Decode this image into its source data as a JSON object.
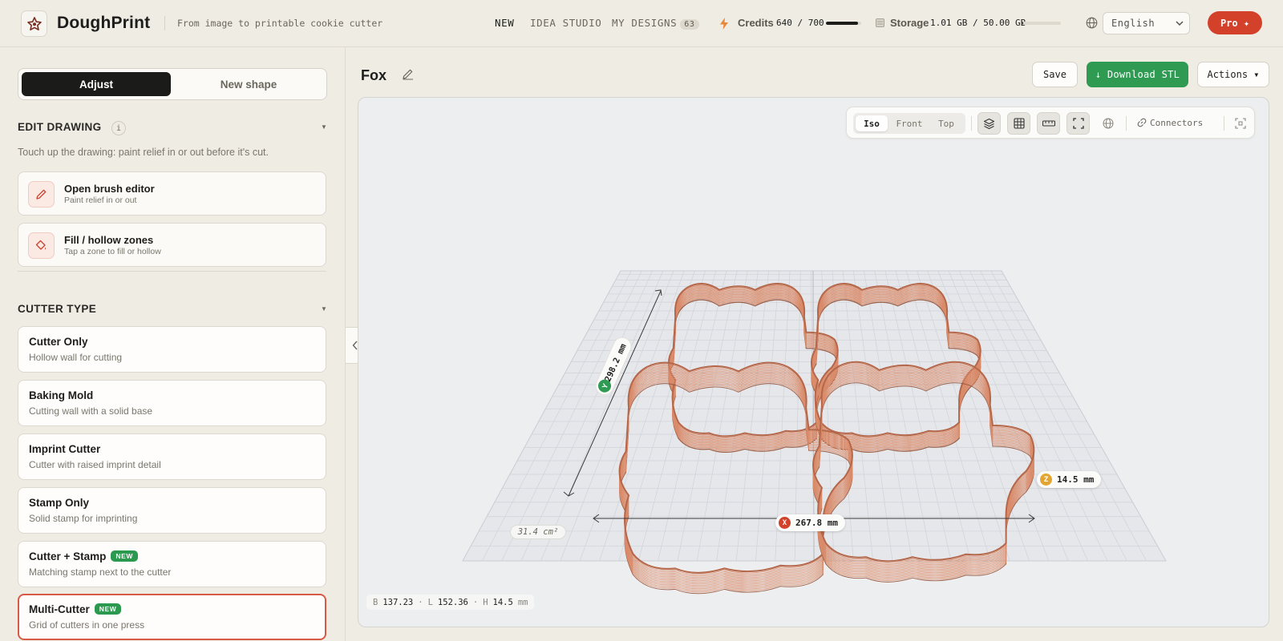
{
  "app": {
    "brand": "DoughPrint",
    "tagline": "From image to printable cookie cutter"
  },
  "nav": [
    {
      "label": "NEW"
    },
    {
      "label": "IDEA STUDIO"
    },
    {
      "label": "MY DESIGNS",
      "count": "63"
    }
  ],
  "credits": {
    "label": "Credits",
    "value": "640 / 700",
    "used": 640,
    "total": 700
  },
  "storage": {
    "label": "Storage",
    "value": "1.01 GB / 50.00 GB",
    "used_gb": 1.01,
    "total_gb": 50.0
  },
  "language": {
    "selected": "English"
  },
  "pro_button": "Pro ✦",
  "left_panel": {
    "tabs": {
      "active": "Adjust",
      "inactive": "New shape"
    },
    "edit_drawing": {
      "title": "EDIT DRAWING",
      "info": "i",
      "description": "Touch up the drawing: paint relief in or out before it's cut.",
      "tools": [
        {
          "title": "Open brush editor",
          "subtitle": "Paint relief in or out",
          "icon": "pencil-icon"
        },
        {
          "title": "Fill / hollow zones",
          "subtitle": "Tap a zone to fill or hollow",
          "icon": "paint-bucket-icon"
        }
      ]
    },
    "cutter_type": {
      "title": "CUTTER TYPE",
      "options": [
        {
          "title": "Cutter Only",
          "subtitle": "Hollow wall for cutting"
        },
        {
          "title": "Baking Mold",
          "subtitle": "Cutting wall with a solid base"
        },
        {
          "title": "Imprint Cutter",
          "subtitle": "Cutter with raised imprint detail"
        },
        {
          "title": "Stamp Only",
          "subtitle": "Solid stamp for imprinting"
        },
        {
          "title": "Cutter + Stamp",
          "subtitle": "Matching stamp next to the cutter",
          "badge": "NEW"
        },
        {
          "title": "Multi-Cutter",
          "subtitle": "Grid of cutters in one press",
          "badge": "NEW",
          "selected": true
        }
      ]
    }
  },
  "main": {
    "design_name": "Fox",
    "buttons": {
      "save": "Save",
      "download": "↓ Download STL",
      "actions": "Actions ▾"
    }
  },
  "viewer": {
    "views": [
      "Iso",
      "Front",
      "Top"
    ],
    "active_view": "Iso",
    "connectors_label": "Connectors",
    "dimensions": {
      "y": {
        "axis": "Y",
        "value": "298.2 mm"
      },
      "x": {
        "axis": "X",
        "value": "267.8 mm"
      },
      "z": {
        "axis": "Z",
        "value": "14.5 mm"
      }
    },
    "area": "31.4 cm²",
    "bounds": {
      "b_label": "B",
      "b": "137.23",
      "l_label": "L",
      "l": "152.36",
      "h_label": "H",
      "h": "14.5",
      "unit": "mm"
    },
    "cutter_color": "#d98b6a"
  },
  "colors": {
    "accent": "#d4412b",
    "download": "#2e9a52",
    "selected_border": "#d85a45",
    "new_badge": "#2b9a4f"
  }
}
